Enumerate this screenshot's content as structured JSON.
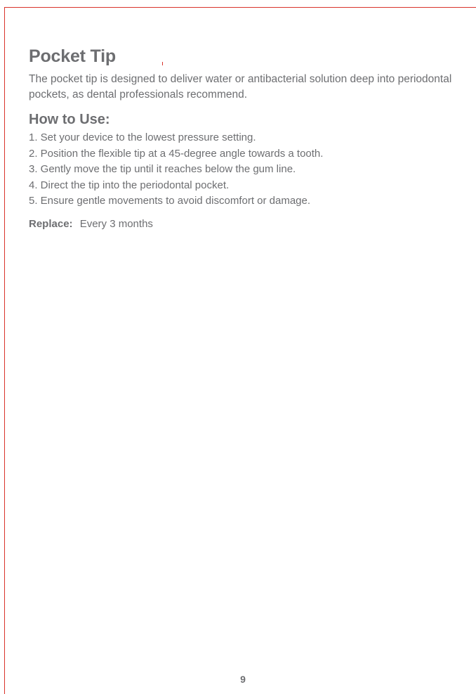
{
  "document": {
    "title": "Pocket Tip",
    "intro": "The pocket tip is designed to deliver water or antibacterial solution deep into periodontal pockets, as dental professionals recommend.",
    "how_to_use": {
      "heading": "How to Use:",
      "steps": [
        "1. Set your device to the lowest pressure setting.",
        "2. Position the flexible tip at a 45-degree angle towards a tooth.",
        "3. Gently move the tip until it reaches below the gum line.",
        "4. Direct the tip into the periodontal pocket.",
        "5. Ensure gentle movements to avoid discomfort or damage."
      ]
    },
    "replace": {
      "label": "Replace:",
      "value": "Every 3 months"
    },
    "page_number": "9"
  },
  "colors": {
    "text": "#6d6e71",
    "accent_rule": "#d9342b",
    "background": "#ffffff"
  }
}
